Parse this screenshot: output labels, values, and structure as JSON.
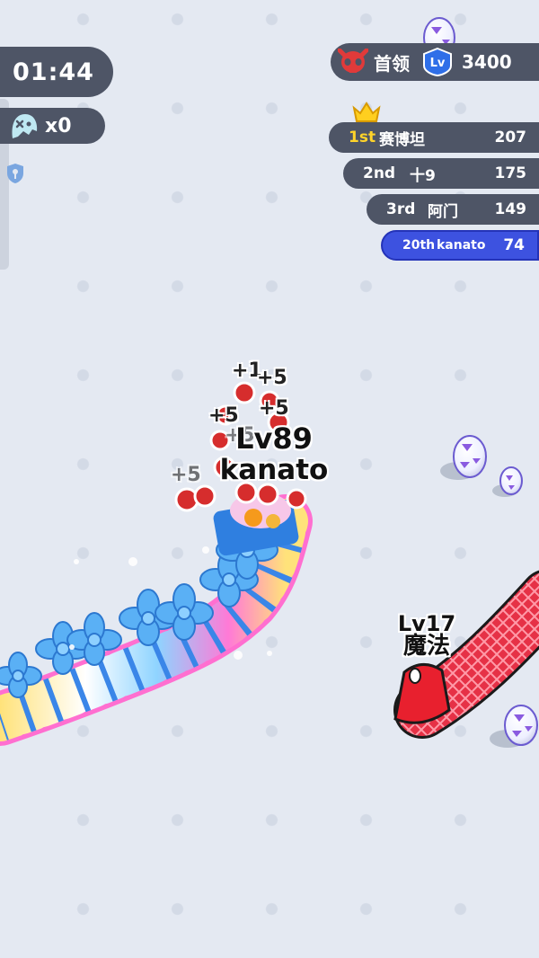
{
  "hud": {
    "timer": "01:44",
    "kills": "x0",
    "boss_label": "首领",
    "boss_badge": "Lv",
    "boss_score": "3400"
  },
  "leaderboard": [
    {
      "pos": "1st",
      "name": "赛博坦",
      "score": "207"
    },
    {
      "pos": "2nd",
      "name": "十9",
      "score": "175"
    },
    {
      "pos": "3rd",
      "name": "阿门",
      "score": "149"
    },
    {
      "pos": "20th",
      "name": "kanato",
      "score": "74"
    }
  ],
  "player": {
    "level": "Lv89",
    "name": "kanato"
  },
  "enemy": {
    "level": "Lv17",
    "name": "魔法"
  },
  "score_popups": [
    "+1",
    "+5",
    "+5",
    "+5",
    "+5",
    "+5"
  ],
  "colors": {
    "hud_bg": "#4e5566",
    "my_rank": "#3d52e0",
    "first_place": "#ffd42a",
    "enemy_snake": "#e63146",
    "player_bow": "#4aa0f0"
  },
  "icons": [
    "ghost-icon",
    "shield-icon",
    "skull-icon",
    "level-badge-icon",
    "crown-icon",
    "egg-icon"
  ]
}
